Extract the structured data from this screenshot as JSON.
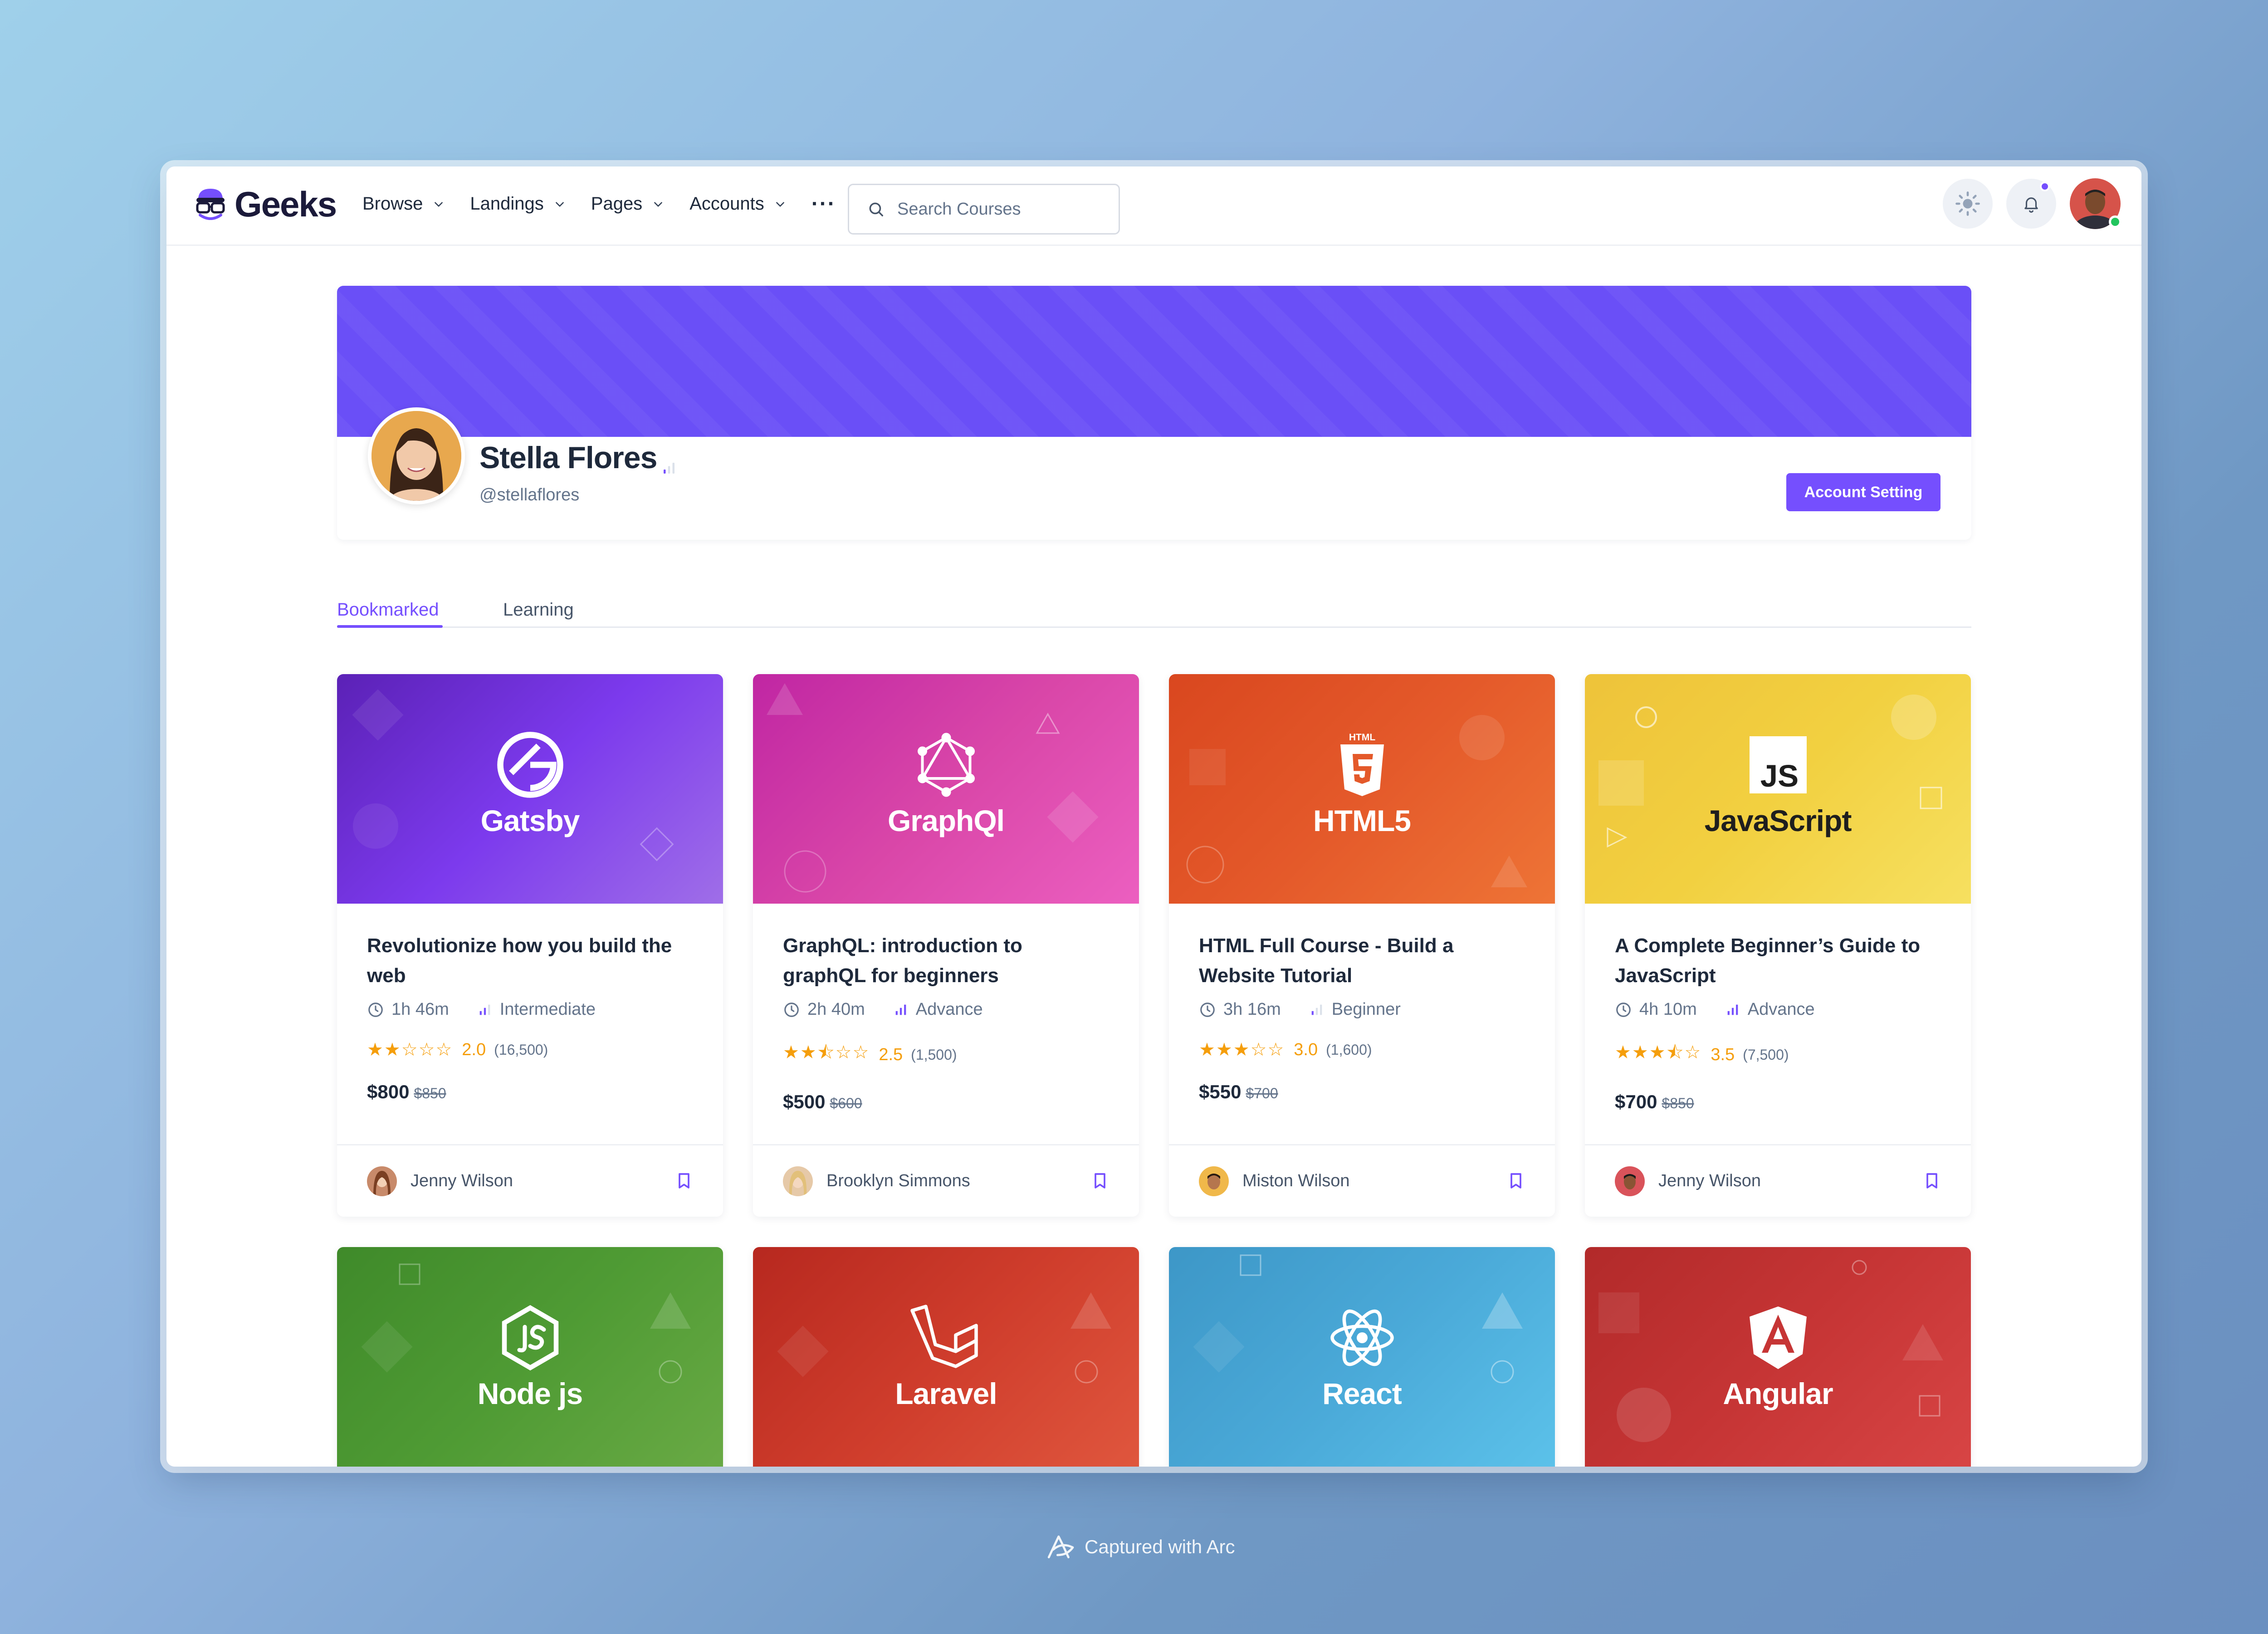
{
  "colors": {
    "primary": "#754ffe",
    "banner": "#6a4ff7",
    "star": "#f59e0b",
    "online": "#22c55e"
  },
  "brand": {
    "name": "Geeks"
  },
  "nav": {
    "items": [
      {
        "label": "Browse",
        "icon": "chevron-down-icon"
      },
      {
        "label": "Landings",
        "icon": "chevron-down-icon"
      },
      {
        "label": "Pages",
        "icon": "chevron-down-icon"
      },
      {
        "label": "Accounts",
        "icon": "chevron-down-icon"
      }
    ],
    "more": "···",
    "search_placeholder": "Search Courses"
  },
  "profile": {
    "name": "Stella Flores",
    "handle": "@stellaflores",
    "account_button": "Account Setting"
  },
  "tabs": [
    {
      "label": "Bookmarked",
      "active": true
    },
    {
      "label": "Learning",
      "active": false
    }
  ],
  "courses": [
    {
      "brand": "Gatsby",
      "title": "Revolutionize how you build the web",
      "duration": "1h 46m",
      "level": "Intermediate",
      "rating": "2.0",
      "stars": 2,
      "reviews": "(16,500)",
      "price": "$800",
      "old_price": "$850",
      "author": "Jenny Wilson"
    },
    {
      "brand": "GraphQl",
      "title": "GraphQL: introduction to graphQL for beginners",
      "duration": "2h 40m",
      "level": "Advance",
      "rating": "2.5",
      "stars": 2.5,
      "reviews": "(1,500)",
      "price": "$500",
      "old_price": "$600",
      "author": "Brooklyn Simmons"
    },
    {
      "brand": "HTML5",
      "title": "HTML Full Course - Build a Website Tutorial",
      "duration": "3h 16m",
      "level": "Beginner",
      "rating": "3.0",
      "stars": 3,
      "reviews": "(1,600)",
      "price": "$550",
      "old_price": "$700",
      "author": "Miston Wilson"
    },
    {
      "brand": "JavaScript",
      "title": "A Complete Beginner’s Guide to JavaScript",
      "duration": "4h 10m",
      "level": "Advance",
      "rating": "3.5",
      "stars": 3.5,
      "reviews": "(7,500)",
      "price": "$700",
      "old_price": "$850",
      "author": "Jenny Wilson"
    },
    {
      "brand": "Node js"
    },
    {
      "brand": "Laravel"
    },
    {
      "brand": "React"
    },
    {
      "brand": "Angular"
    }
  ],
  "footer_caption": "Captured with Arc"
}
